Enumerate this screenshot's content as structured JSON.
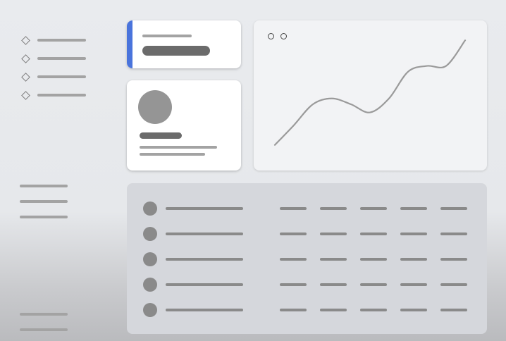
{
  "sidebar": {
    "nav_items": [
      {
        "icon": "diamond-icon"
      },
      {
        "icon": "diamond-icon"
      },
      {
        "icon": "diamond-icon"
      },
      {
        "icon": "diamond-icon"
      }
    ],
    "group_lines": 3,
    "footer_lines": 2
  },
  "stat_card": {
    "accent_color": "#4a74dc"
  },
  "profile_card": {
    "avatar_color": "#959595"
  },
  "chart_card": {
    "legend_markers": [
      "marker-a",
      "marker-b"
    ],
    "line_color": "#9a9a9a"
  },
  "chart_data": {
    "type": "line",
    "title": "",
    "xlabel": "",
    "ylabel": "",
    "x": [
      0,
      1,
      2,
      3,
      4,
      5,
      6,
      7,
      8,
      9,
      10
    ],
    "series": [
      {
        "values": [
          5,
          22,
          40,
          45,
          40,
          33,
          45,
          68,
          73,
          73,
          95
        ]
      }
    ],
    "ylim": [
      0,
      100
    ],
    "grid": false,
    "legend": "top-left"
  },
  "table": {
    "rows": [
      {
        "cells": 5
      },
      {
        "cells": 5
      },
      {
        "cells": 5
      },
      {
        "cells": 5
      },
      {
        "cells": 5
      }
    ]
  },
  "colors": {
    "background": "#e8eaed",
    "placeholder": "#a3a3a3",
    "accent": "#4a74dc"
  }
}
